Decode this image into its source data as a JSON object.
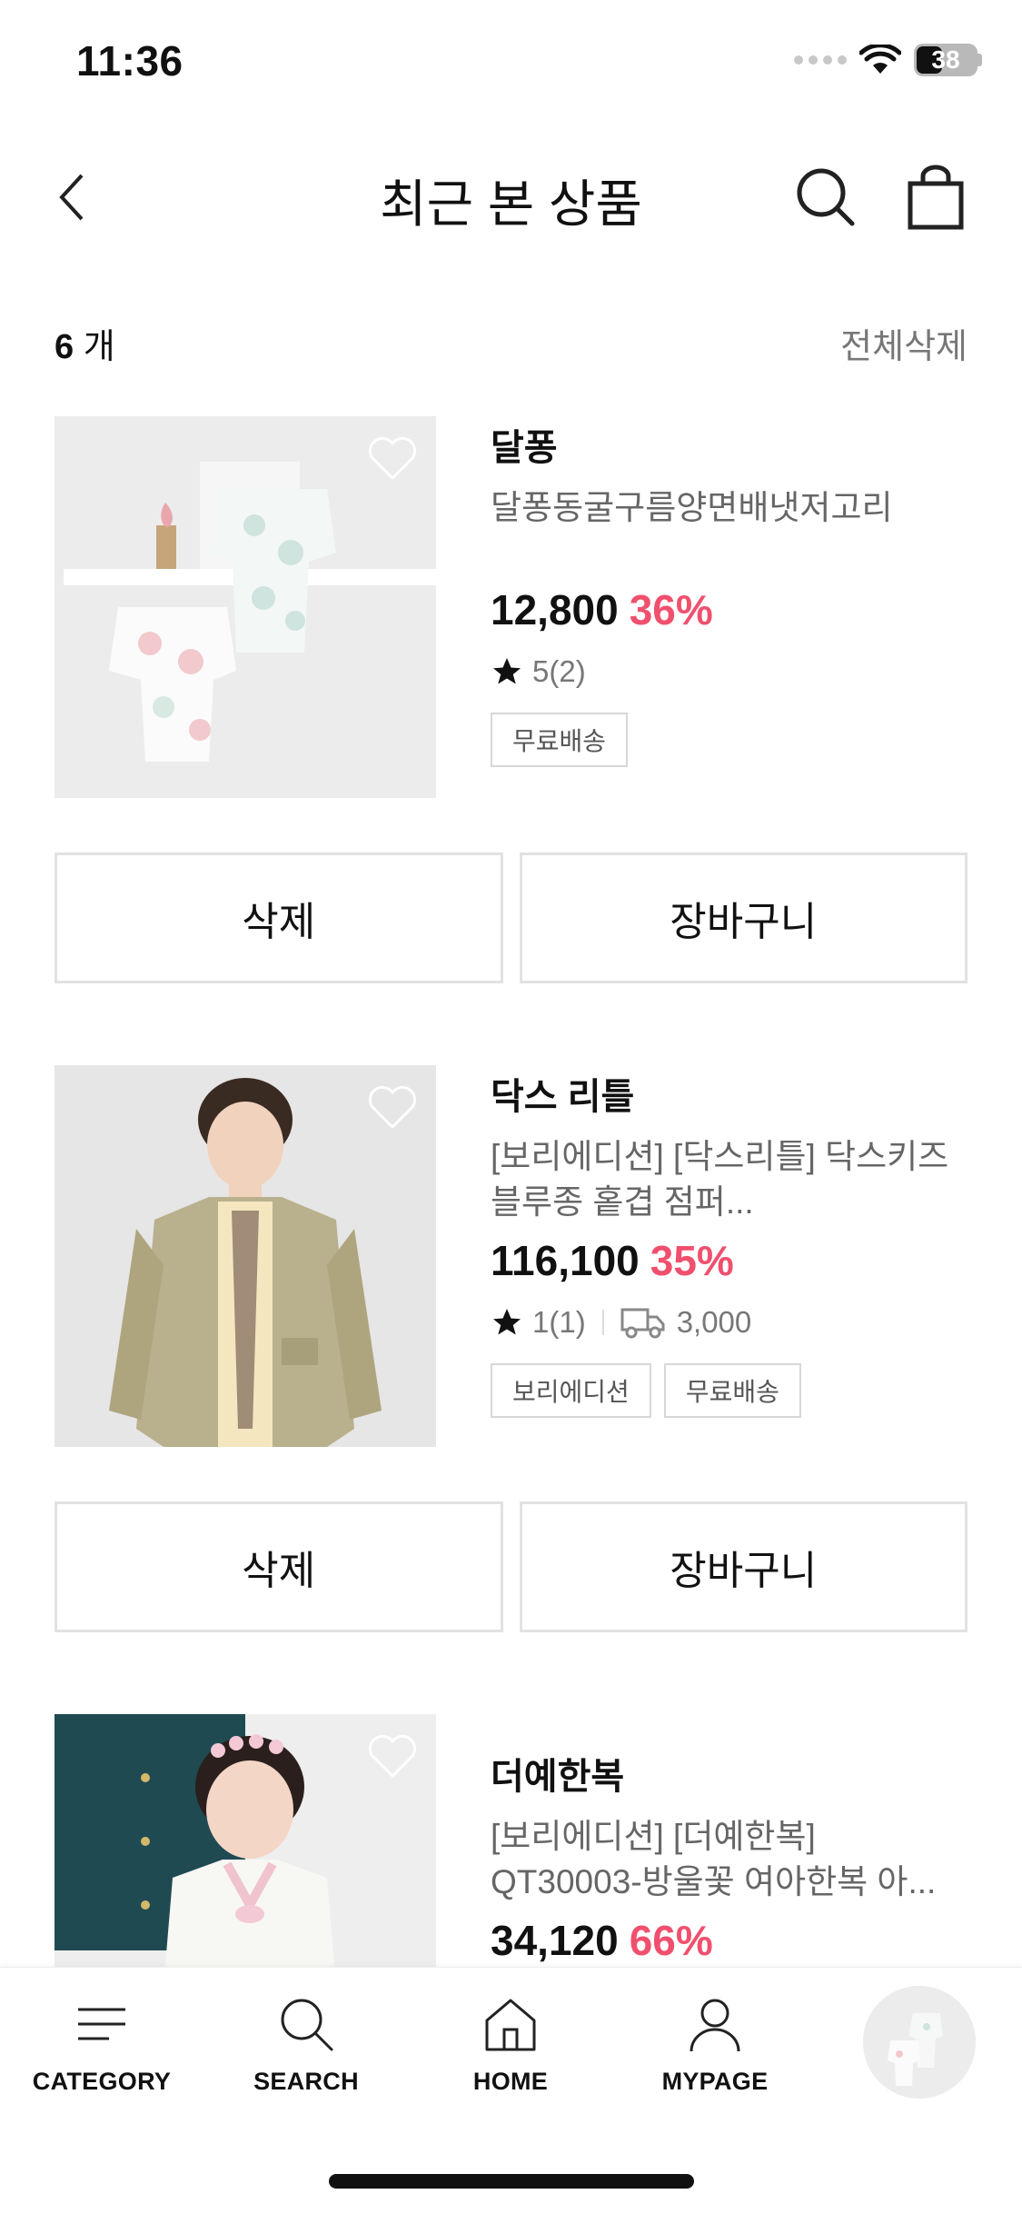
{
  "status_bar": {
    "time": "11:36",
    "battery": "38"
  },
  "header": {
    "title": "최근 본 상품"
  },
  "list": {
    "count_num": "6",
    "count_unit": "개",
    "delete_all": "전체삭제"
  },
  "products": [
    {
      "brand": "달퐁",
      "name": "달퐁동굴구름양면배냇저고리",
      "price": "12,800",
      "discount": "36%",
      "rating": "5(2)",
      "tags": [
        "무료배송"
      ],
      "delete_label": "삭제",
      "cart_label": "장바구니"
    },
    {
      "brand": "닥스 리틀",
      "name_line1": "[보리에디션] [닥스리틀] 닥스키즈",
      "name_line2": "블루종 홑겹 점퍼...",
      "price": "116,100",
      "discount": "35%",
      "rating": "1(1)",
      "shipping": "3,000",
      "tags": [
        "보리에디션",
        "무료배송"
      ],
      "delete_label": "삭제",
      "cart_label": "장바구니"
    },
    {
      "brand": "더예한복",
      "name_line1": "[보리에디션] [더예한복]",
      "name_line2": "QT30003-방울꽃 여아한복 아...",
      "price": "34,120",
      "discount": "66%"
    }
  ],
  "bottom_nav": {
    "category": "CATEGORY",
    "search": "SEARCH",
    "home": "HOME",
    "mypage": "MYPAGE"
  },
  "colors": {
    "discount": "#f0506e",
    "border": "#e2e2e2",
    "muted": "#777777"
  },
  "icons": [
    "back-icon",
    "search-icon",
    "bag-icon",
    "heart-icon",
    "star-icon",
    "truck-icon",
    "menu-icon",
    "home-icon",
    "user-icon"
  ]
}
